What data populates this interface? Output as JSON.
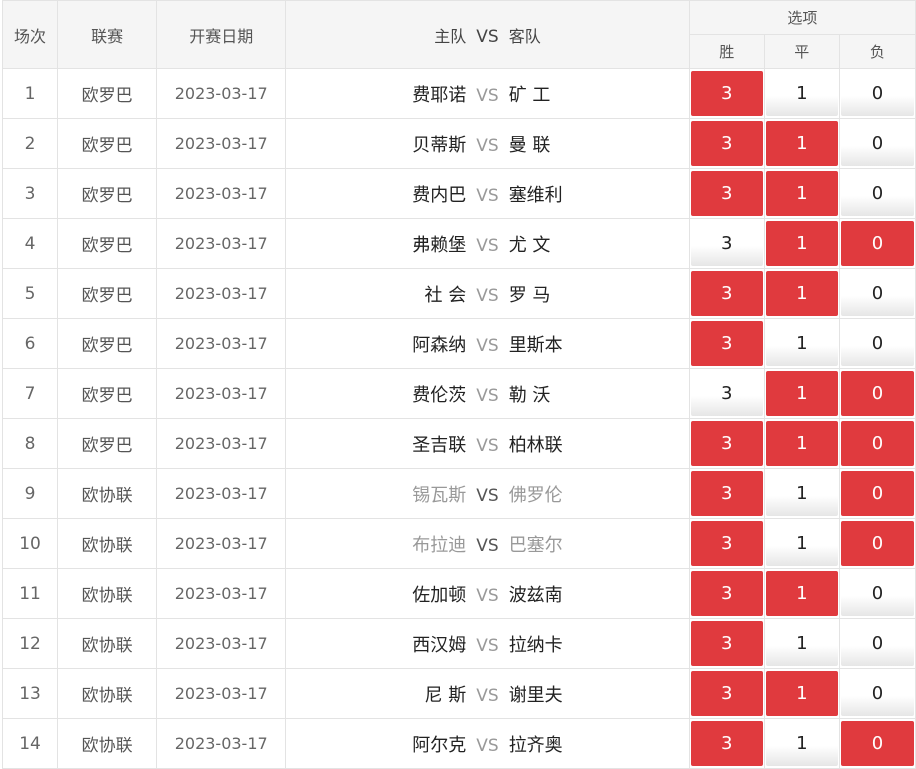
{
  "header": {
    "col_index": "场次",
    "col_league": "联赛",
    "col_date": "开赛日期",
    "col_home": "主队",
    "col_vs": "VS",
    "col_away": "客队",
    "col_options": "选项",
    "opt_win": "胜",
    "opt_draw": "平",
    "opt_lose": "负"
  },
  "vs_label": "VS",
  "colors": {
    "selected": "#e03a3e",
    "unselected": "#ffffff"
  },
  "rows": [
    {
      "index": "1",
      "league": "欧罗巴",
      "date": "2023-03-17",
      "home": "费耶诺",
      "away": "矿 工",
      "win": "3",
      "draw": "1",
      "lose": "0",
      "sel": [
        true,
        false,
        false
      ],
      "muted": false
    },
    {
      "index": "2",
      "league": "欧罗巴",
      "date": "2023-03-17",
      "home": "贝蒂斯",
      "away": "曼 联",
      "win": "3",
      "draw": "1",
      "lose": "0",
      "sel": [
        true,
        true,
        false
      ],
      "muted": false
    },
    {
      "index": "3",
      "league": "欧罗巴",
      "date": "2023-03-17",
      "home": "费内巴",
      "away": "塞维利",
      "win": "3",
      "draw": "1",
      "lose": "0",
      "sel": [
        true,
        true,
        false
      ],
      "muted": false
    },
    {
      "index": "4",
      "league": "欧罗巴",
      "date": "2023-03-17",
      "home": "弗赖堡",
      "away": "尤 文",
      "win": "3",
      "draw": "1",
      "lose": "0",
      "sel": [
        false,
        true,
        true
      ],
      "muted": false
    },
    {
      "index": "5",
      "league": "欧罗巴",
      "date": "2023-03-17",
      "home": "社 会",
      "away": "罗 马",
      "win": "3",
      "draw": "1",
      "lose": "0",
      "sel": [
        true,
        true,
        false
      ],
      "muted": false
    },
    {
      "index": "6",
      "league": "欧罗巴",
      "date": "2023-03-17",
      "home": "阿森纳",
      "away": "里斯本",
      "win": "3",
      "draw": "1",
      "lose": "0",
      "sel": [
        true,
        false,
        false
      ],
      "muted": false
    },
    {
      "index": "7",
      "league": "欧罗巴",
      "date": "2023-03-17",
      "home": "费伦茨",
      "away": "勒 沃",
      "win": "3",
      "draw": "1",
      "lose": "0",
      "sel": [
        false,
        true,
        true
      ],
      "muted": false
    },
    {
      "index": "8",
      "league": "欧罗巴",
      "date": "2023-03-17",
      "home": "圣吉联",
      "away": "柏林联",
      "win": "3",
      "draw": "1",
      "lose": "0",
      "sel": [
        true,
        true,
        true
      ],
      "muted": false
    },
    {
      "index": "9",
      "league": "欧协联",
      "date": "2023-03-17",
      "home": "锡瓦斯",
      "away": "佛罗伦",
      "win": "3",
      "draw": "1",
      "lose": "0",
      "sel": [
        true,
        false,
        true
      ],
      "muted": true
    },
    {
      "index": "10",
      "league": "欧协联",
      "date": "2023-03-17",
      "home": "布拉迪",
      "away": "巴塞尔",
      "win": "3",
      "draw": "1",
      "lose": "0",
      "sel": [
        true,
        false,
        true
      ],
      "muted": true
    },
    {
      "index": "11",
      "league": "欧协联",
      "date": "2023-03-17",
      "home": "佐加顿",
      "away": "波兹南",
      "win": "3",
      "draw": "1",
      "lose": "0",
      "sel": [
        true,
        true,
        false
      ],
      "muted": false
    },
    {
      "index": "12",
      "league": "欧协联",
      "date": "2023-03-17",
      "home": "西汉姆",
      "away": "拉纳卡",
      "win": "3",
      "draw": "1",
      "lose": "0",
      "sel": [
        true,
        false,
        false
      ],
      "muted": false
    },
    {
      "index": "13",
      "league": "欧协联",
      "date": "2023-03-17",
      "home": "尼 斯",
      "away": "谢里夫",
      "win": "3",
      "draw": "1",
      "lose": "0",
      "sel": [
        true,
        true,
        false
      ],
      "muted": false
    },
    {
      "index": "14",
      "league": "欧协联",
      "date": "2023-03-17",
      "home": "阿尔克",
      "away": "拉齐奥",
      "win": "3",
      "draw": "1",
      "lose": "0",
      "sel": [
        true,
        false,
        true
      ],
      "muted": false
    }
  ]
}
